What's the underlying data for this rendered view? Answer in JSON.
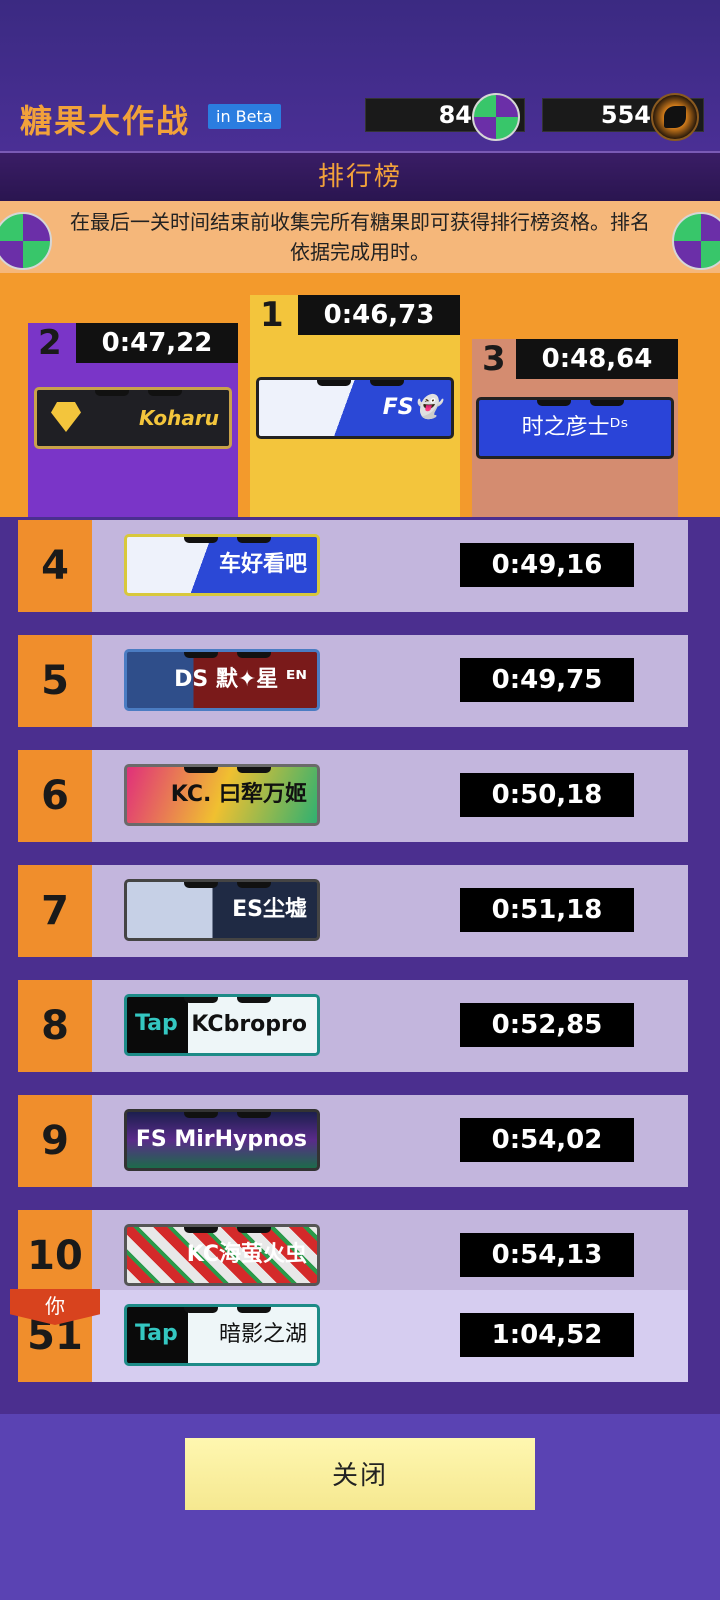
{
  "app": {
    "title": "糖果大作战",
    "beta": "in Beta"
  },
  "currency": {
    "candy": "84",
    "dragon": "554"
  },
  "header": "排行榜",
  "info": "在最后一关时间结束前收集完所有糖果即可获得排行榜资格。排名依据完成用时。",
  "podium": {
    "first": {
      "rank": "1",
      "time": "0:46,73",
      "player": "FS👻"
    },
    "second": {
      "rank": "2",
      "time": "0:47,22",
      "player": "Koharu"
    },
    "third": {
      "rank": "3",
      "time": "0:48,64",
      "player": "时之彦士ᴰˢ"
    }
  },
  "rows": [
    {
      "rank": "4",
      "player": "车好看吧",
      "time": "0:49,16"
    },
    {
      "rank": "5",
      "player": "DS 默✦星 ᴱᴺ",
      "time": "0:49,75"
    },
    {
      "rank": "6",
      "player": "KC. 曰犂万姬",
      "time": "0:50,18"
    },
    {
      "rank": "7",
      "player": "ES尘墟",
      "time": "0:51,18"
    },
    {
      "rank": "8",
      "player": "KCbropro",
      "time": "0:52,85"
    },
    {
      "rank": "9",
      "player": "FS MirHypnos",
      "time": "0:54,02"
    },
    {
      "rank": "10",
      "player": "KC海萤火虫",
      "time": "0:54,13"
    }
  ],
  "you": {
    "badge": "你",
    "rank": "51",
    "player": "暗影之湖",
    "time": "1:04,52"
  },
  "close_label": "关闭",
  "colors": {
    "accent": "#f2a23a",
    "rank_bg": "#f08e2c",
    "row_bg": "#c3b6dd"
  }
}
